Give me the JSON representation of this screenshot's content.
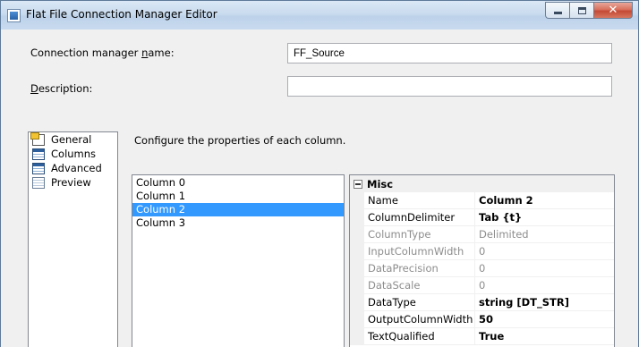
{
  "window": {
    "title": "Flat File Connection Manager Editor"
  },
  "form": {
    "conn_name_label": "Connection manager name:",
    "conn_name_value": "FF_Source",
    "description_label": "Description:",
    "description_value": ""
  },
  "nav": {
    "items": [
      {
        "label": "General",
        "icon": "general-icon"
      },
      {
        "label": "Columns",
        "icon": "columns-icon"
      },
      {
        "label": "Advanced",
        "icon": "advanced-icon"
      },
      {
        "label": "Preview",
        "icon": "preview-icon"
      }
    ]
  },
  "main": {
    "heading": "Configure the properties of each column.",
    "columns": [
      "Column 0",
      "Column 1",
      "Column 2",
      "Column 3"
    ],
    "selected_column": "Column 2"
  },
  "properties": {
    "category": "Misc",
    "rows": [
      {
        "name": "Name",
        "value": "Column 2",
        "state": "modified"
      },
      {
        "name": "ColumnDelimiter",
        "value": "Tab {t}",
        "state": "modified"
      },
      {
        "name": "ColumnType",
        "value": "Delimited",
        "state": "readonly"
      },
      {
        "name": "InputColumnWidth",
        "value": "0",
        "state": "readonly"
      },
      {
        "name": "DataPrecision",
        "value": "0",
        "state": "readonly"
      },
      {
        "name": "DataScale",
        "value": "0",
        "state": "readonly"
      },
      {
        "name": "DataType",
        "value": "string [DT_STR]",
        "state": "modified"
      },
      {
        "name": "OutputColumnWidth",
        "value": "50",
        "state": "modified"
      },
      {
        "name": "TextQualified",
        "value": "True",
        "state": "modified"
      }
    ]
  },
  "colors": {
    "selection": "#3399ff",
    "readonly_text": "#8d8d8d",
    "close_button": "#c44a35"
  }
}
